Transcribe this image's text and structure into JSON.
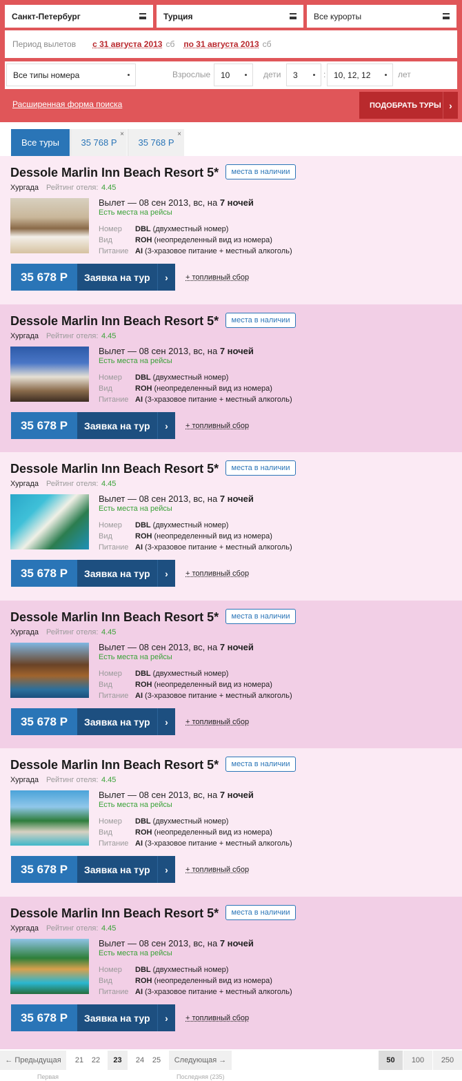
{
  "search": {
    "city": "Санкт-Петербург",
    "country": "Турция",
    "resorts": "Все курорты",
    "period_label": "Период вылетов",
    "date_from": "с 31 августа 2013",
    "date_from_day": "сб",
    "date_to": "по 31 августа 2013",
    "date_to_day": "сб",
    "room_type": "Все типы номера",
    "adults_label": "Взрослые",
    "adults": "10",
    "children_label": "дети",
    "children": "3",
    "separator": ":",
    "ages": "10, 12, 12",
    "years_label": "лет",
    "advanced_link": "Расширенная форма поиска",
    "find_button": "ПОДОБРАТЬ ТУРЫ",
    "find_chevron": "›"
  },
  "tabs": [
    {
      "label": "Все туры"
    },
    {
      "label": "35 768 Р",
      "close": "×"
    },
    {
      "label": "35 768 Р",
      "close": "×"
    }
  ],
  "cards": [
    {
      "name": "Dessole Marlin Inn Beach Resort 5*",
      "badge": "места в наличии",
      "city": "Хургада",
      "rating_label": "Рейтинг отеля:",
      "rating": "4.45",
      "departure_prefix": "Вылет — 08 сен 2013, вс, на ",
      "nights": "7 ночей",
      "availability": "Есть места на рейсы",
      "room_label": "Номер",
      "room_code": "DBL",
      "room_desc": " (двухместный номер)",
      "view_label": "Вид",
      "view_code": "ROH",
      "view_desc": " (неопределенный вид из номера)",
      "meal_label": "Питание",
      "meal_code": "AI",
      "meal_desc": " (3-хразовое питание + местный алкоголь)",
      "price": "35 678 Р",
      "order": "Заявка на тур",
      "chevron": "›",
      "fuel": "+ топливный сбор",
      "bg": "#fbeaf4"
    },
    {
      "name": "Dessole Marlin Inn Beach Resort 5*",
      "badge": "места в наличии",
      "city": "Хургада",
      "rating_label": "Рейтинг отеля:",
      "rating": "4.45",
      "departure_prefix": "Вылет — 08 сен 2013, вс, на ",
      "nights": "7 ночей",
      "availability": "Есть места на рейсы",
      "room_label": "Номер",
      "room_code": "DBL",
      "room_desc": " (двухместный номер)",
      "view_label": "Вид",
      "view_code": "ROH",
      "view_desc": " (неопределенный вид из номера)",
      "meal_label": "Питание",
      "meal_code": "AI",
      "meal_desc": " (3-хразовое питание + местный алкоголь)",
      "price": "35 678 Р",
      "order": "Заявка на тур",
      "chevron": "›",
      "fuel": "+ топливный сбор",
      "bg": "#f2cfe6"
    },
    {
      "name": "Dessole Marlin Inn Beach Resort 5*",
      "badge": "места в наличии",
      "city": "Хургада",
      "rating_label": "Рейтинг отеля:",
      "rating": "4.45",
      "departure_prefix": "Вылет — 08 сен 2013, вс, на ",
      "nights": "7 ночей",
      "availability": "Есть места на рейсы",
      "room_label": "Номер",
      "room_code": "DBL",
      "room_desc": " (двухместный номер)",
      "view_label": "Вид",
      "view_code": "ROH",
      "view_desc": " (неопределенный вид из номера)",
      "meal_label": "Питание",
      "meal_code": "AI",
      "meal_desc": " (3-хразовое питание + местный алкоголь)",
      "price": "35 678 Р",
      "order": "Заявка на тур",
      "chevron": "›",
      "fuel": "+ топливный сбор",
      "bg": "#fbeaf4"
    },
    {
      "name": "Dessole Marlin Inn Beach Resort 5*",
      "badge": "места в наличии",
      "city": "Хургада",
      "rating_label": "Рейтинг отеля:",
      "rating": "4.45",
      "departure_prefix": "Вылет — 08 сен 2013, вс, на ",
      "nights": "7 ночей",
      "availability": "Есть места на рейсы",
      "room_label": "Номер",
      "room_code": "DBL",
      "room_desc": " (двухместный номер)",
      "view_label": "Вид",
      "view_code": "ROH",
      "view_desc": " (неопределенный вид из номера)",
      "meal_label": "Питание",
      "meal_code": "AI",
      "meal_desc": " (3-хразовое питание + местный алкоголь)",
      "price": "35 678 Р",
      "order": "Заявка на тур",
      "chevron": "›",
      "fuel": "+ топливный сбор",
      "bg": "#f2cfe6"
    },
    {
      "name": "Dessole Marlin Inn Beach Resort 5*",
      "badge": "места в наличии",
      "city": "Хургада",
      "rating_label": "Рейтинг отеля:",
      "rating": "4.45",
      "departure_prefix": "Вылет — 08 сен 2013, вс, на ",
      "nights": "7 ночей",
      "availability": "Есть места на рейсы",
      "room_label": "Номер",
      "room_code": "DBL",
      "room_desc": " (двухместный номер)",
      "view_label": "Вид",
      "view_code": "ROH",
      "view_desc": " (неопределенный вид из номера)",
      "meal_label": "Питание",
      "meal_code": "AI",
      "meal_desc": " (3-хразовое питание + местный алкоголь)",
      "price": "35 678 Р",
      "order": "Заявка на тур",
      "chevron": "›",
      "fuel": "+ топливный сбор",
      "bg": "#fbeaf4"
    },
    {
      "name": "Dessole Marlin Inn Beach Resort 5*",
      "badge": "места в наличии",
      "city": "Хургада",
      "rating_label": "Рейтинг отеля:",
      "rating": "4.45",
      "departure_prefix": "Вылет — 08 сен 2013, вс, на ",
      "nights": "7 ночей",
      "availability": "Есть места на рейсы",
      "room_label": "Номер",
      "room_code": "DBL",
      "room_desc": " (двухместный номер)",
      "view_label": "Вид",
      "view_code": "ROH",
      "view_desc": " (неопределенный вид из номера)",
      "meal_label": "Питание",
      "meal_code": "AI",
      "meal_desc": " (3-хразовое питание + местный алкоголь)",
      "price": "35 678 Р",
      "order": "Заявка на тур",
      "chevron": "›",
      "fuel": "+ топливный сбор",
      "bg": "#f2cfe6"
    }
  ],
  "pager": {
    "prev": "← Предыдущая",
    "first": "Первая",
    "pages": [
      "21",
      "22",
      "23",
      "24",
      "25"
    ],
    "current": "23",
    "next": "Следующая →",
    "last": "Последняя (235)",
    "per_page": [
      "50",
      "100",
      "250"
    ],
    "per_page_current": "50"
  },
  "colors": {
    "accent": "#e05659",
    "blue": "#2a75b7",
    "dark_blue": "#1d4f80",
    "green": "#3aa238"
  }
}
